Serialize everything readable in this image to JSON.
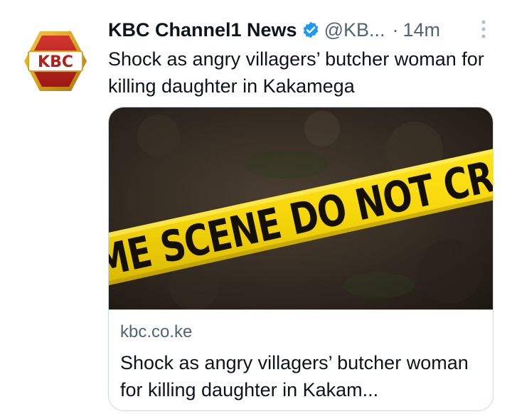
{
  "tweet": {
    "avatar_label": "KBC",
    "display_name": "KBC Channel1 News",
    "verified_icon": "verified-badge-icon",
    "handle": "@KB...",
    "separator": "·",
    "timestamp": "14m",
    "more_icon": "more-vertical-icon",
    "text": "Shock as angry villagers’ butcher woman for killing daughter in Kakamega"
  },
  "card": {
    "image_text": "CRIME SCENE DO NOT CROSS",
    "domain": "kbc.co.ke",
    "title": "Shock as angry villagers’ butcher woman for killing daughter in Kakam..."
  },
  "colors": {
    "verified_blue": "#1d9bf0",
    "muted_text": "#536471",
    "tape_yellow": "#f5d90a",
    "kbc_red": "#b21f1c",
    "kbc_gold": "#d9a21b"
  }
}
